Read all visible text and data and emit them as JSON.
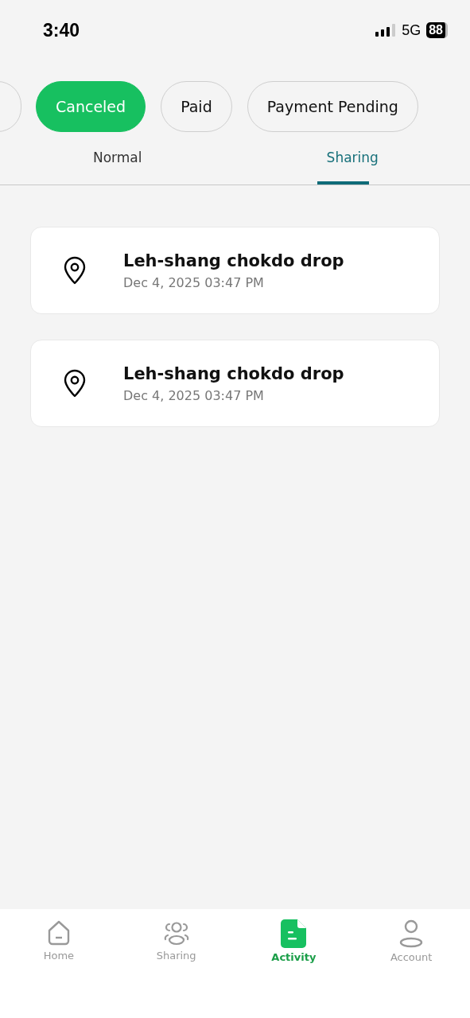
{
  "status_bar": {
    "time": "3:40",
    "network": "5G",
    "battery": "88"
  },
  "filters": [
    {
      "label": "Canceled",
      "selected": true
    },
    {
      "label": "Paid",
      "selected": false
    },
    {
      "label": "Payment Pending",
      "selected": false
    }
  ],
  "tabs": [
    {
      "label": "Normal",
      "selected": false
    },
    {
      "label": "Sharing",
      "selected": true
    }
  ],
  "trips": [
    {
      "title": "Leh-shang chokdo drop",
      "datetime": "Dec 4, 2025 03:47 PM"
    },
    {
      "title": "Leh-shang chokdo drop",
      "datetime": "Dec 4, 2025 03:47 PM"
    }
  ],
  "nav": [
    {
      "kind": "home",
      "label": "Home",
      "selected": false
    },
    {
      "kind": "sharing",
      "label": "Sharing",
      "selected": false
    },
    {
      "kind": "activity",
      "label": "Activity",
      "selected": true
    },
    {
      "kind": "account",
      "label": "Account",
      "selected": false
    }
  ]
}
